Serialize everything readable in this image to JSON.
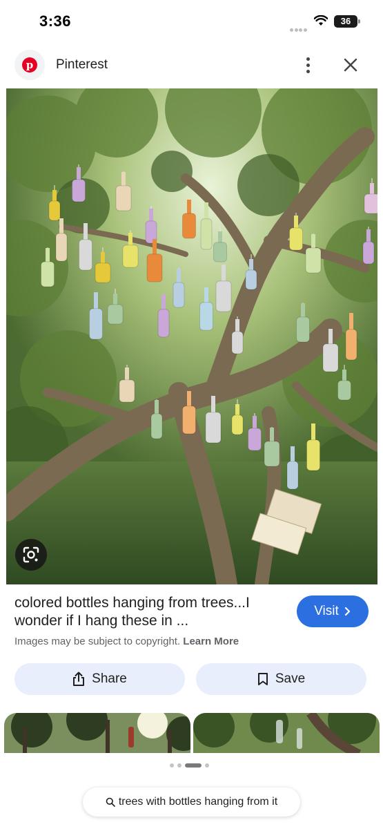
{
  "status_bar": {
    "time": "3:36",
    "battery": "36"
  },
  "header": {
    "site_name": "Pinterest"
  },
  "result": {
    "title": "colored bottles hanging from trees...I wonder if I hang these in ...",
    "copyright_text": "Images may be subject to copyright.",
    "learn_more": "Learn More",
    "visit_label": "Visit"
  },
  "actions": {
    "share_label": "Share",
    "save_label": "Save"
  },
  "search": {
    "query": "trees with bottles hanging from it"
  },
  "pager": {
    "count": 4,
    "active_index": 2
  },
  "icons": {
    "site": "pinterest-logo-icon",
    "more": "more-vertical-icon",
    "close": "close-icon",
    "lens": "google-lens-icon",
    "share": "share-icon",
    "save": "bookmark-icon",
    "search": "search-icon",
    "visit": "chevron-right-icon"
  },
  "colors": {
    "accent": "#2b6fe0",
    "chip_bg": "#e8eefb",
    "pinterest_red": "#e60023"
  }
}
